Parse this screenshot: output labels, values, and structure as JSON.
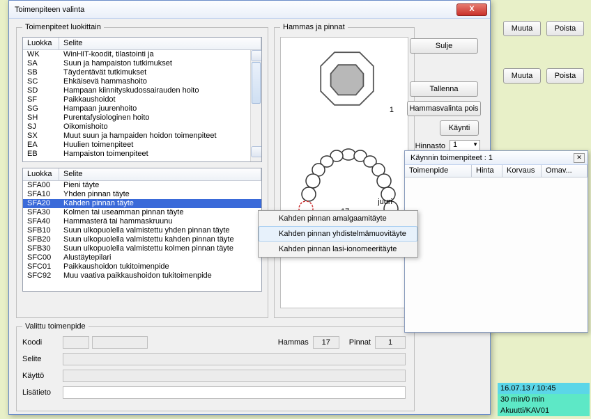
{
  "dialog": {
    "title": "Toimenpiteen valinta",
    "close_x": "X"
  },
  "fs_luokittain": {
    "legend": "Toimenpiteet luokittain",
    "col_luokka": "Luokka",
    "col_selite": "Selite",
    "rows1": [
      {
        "luokka": "WK",
        "selite": "WinHIT-koodit, tilastointi ja"
      },
      {
        "luokka": "SA",
        "selite": "Suun ja hampaiston tutkimukset"
      },
      {
        "luokka": "SB",
        "selite": "Täydentävät tutkimukset"
      },
      {
        "luokka": "SC",
        "selite": "Ehkäisevä hammashoito"
      },
      {
        "luokka": "SD",
        "selite": "Hampaan kiinnityskudossairauden hoito"
      },
      {
        "luokka": "SF",
        "selite": "Paikkaushoidot"
      },
      {
        "luokka": "SG",
        "selite": "Hampaan juurenhoito"
      },
      {
        "luokka": "SH",
        "selite": "Purentafysiologinen hoito"
      },
      {
        "luokka": "SJ",
        "selite": "Oikomishoito"
      },
      {
        "luokka": "SX",
        "selite": "Muut suun ja hampaiden hoidon toimenpiteet"
      },
      {
        "luokka": "EA",
        "selite": "Huulien toimenpiteet"
      },
      {
        "luokka": "EB",
        "selite": "Hampaiston toimenpiteet"
      }
    ],
    "rows2": [
      {
        "luokka": "SFA00",
        "selite": "Pieni täyte"
      },
      {
        "luokka": "SFA10",
        "selite": "Yhden pinnan täyte"
      },
      {
        "luokka": "SFA20",
        "selite": "Kahden pinnan täyte",
        "sel": true
      },
      {
        "luokka": "SFA30",
        "selite": "Kolmen tai useamman pinnan täyte"
      },
      {
        "luokka": "SFA40",
        "selite": "Hammasterä tai hammaskruunu"
      },
      {
        "luokka": "SFB10",
        "selite": "Suun ulkopuolella valmistettu yhden pinnan täyte"
      },
      {
        "luokka": "SFB20",
        "selite": "Suun ulkopuolella valmistettu kahden pinnan täyte"
      },
      {
        "luokka": "SFB30",
        "selite": "Suun ulkopuolella valmistettu kolmen pinnan täyte"
      },
      {
        "luokka": "SFC00",
        "selite": "Alustäytepilari"
      },
      {
        "luokka": "SFC01",
        "selite": "Paikkaushoidon tukitoimenpide"
      },
      {
        "luokka": "SFC92",
        "selite": "Muu vaativa paikkaushoidon tukitoimenpide"
      }
    ]
  },
  "fs_hammas": {
    "legend": "Hammas ja pinnat",
    "num1": "1",
    "num17": "17",
    "q": "?",
    "juuri": "juuri"
  },
  "rightcol": {
    "sulje": "Sulje",
    "tallenna": "Tallenna",
    "hvp": "Hammasvalinta pois",
    "kaynti": "Käynti",
    "hinnasto_lbl": "Hinnasto",
    "hinnasto_val": "1"
  },
  "ctxmenu": {
    "i1": "Kahden pinnan amalgaamitäyte",
    "i2": "Kahden pinnan yhdistelmämuovitäyte",
    "i3": "Kahden pinnan lasi-ionomeeritäyte"
  },
  "fs_valittu": {
    "legend": "Valittu toimenpide",
    "koodi_lbl": "Koodi",
    "selite_lbl": "Selite",
    "kaytto_lbl": "Käyttö",
    "lisatieto_lbl": "Lisätieto",
    "hammas_lbl": "Hammas",
    "hammas_val": "17",
    "pinnat_lbl": "Pinnat",
    "pinnat_val": "1"
  },
  "panel2": {
    "title": "Käynnin toimenpiteet : 1",
    "c1": "Toimenpide",
    "c2": "Hinta",
    "c3": "Korvaus",
    "c4": "Omav..."
  },
  "ext": {
    "muuta": "Muuta",
    "poista": "Poista"
  },
  "bottom": {
    "b1": "16.07.13 / 10:45",
    "b2": "30 min/0 min",
    "b3": "Akuutti/KAV01"
  }
}
